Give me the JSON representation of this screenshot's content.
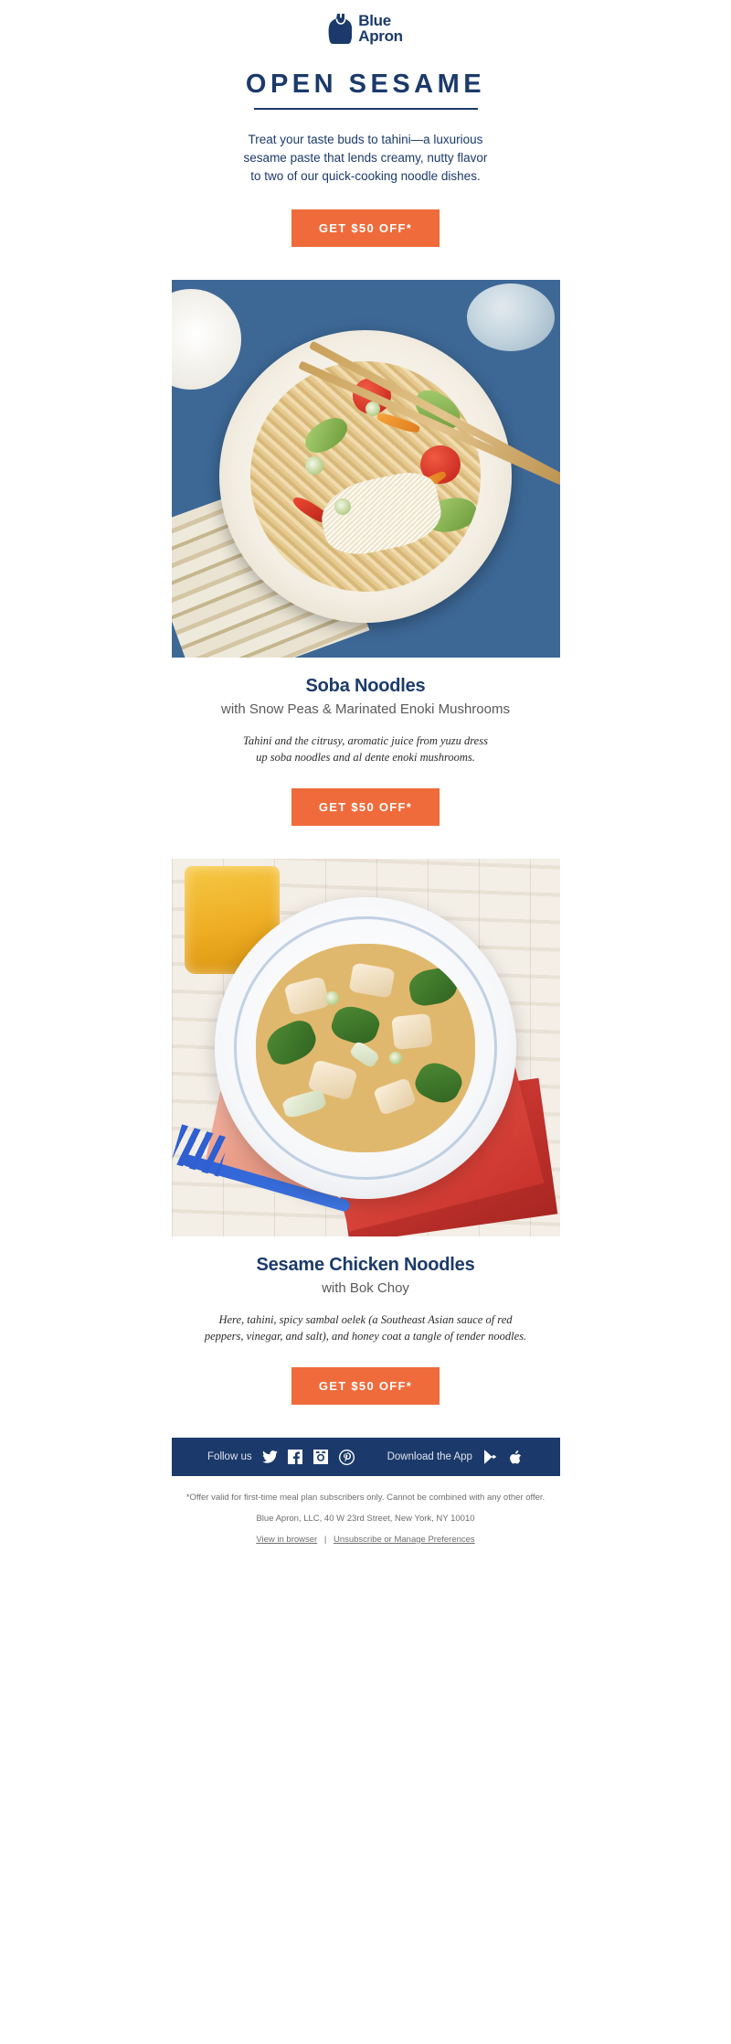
{
  "brand": {
    "name_line1": "Blue",
    "name_line2": "Apron",
    "logo_icon": "apron-icon",
    "navy": "#1b3a6b",
    "orange": "#ef6b3c"
  },
  "hero": {
    "headline": "OPEN SESAME",
    "intro_line1": "Treat your taste buds to tahini—a luxurious",
    "intro_line2": "sesame paste that lends creamy, nutty flavor",
    "intro_line3": "to two of our quick-cooking noodle dishes.",
    "cta_label": "GET $50 OFF*"
  },
  "recipes": [
    {
      "photo_alt": "soba-noodles-photo",
      "title": "Soba Noodles",
      "subtitle": "with Snow Peas & Marinated Enoki Mushrooms",
      "desc_line1": "Tahini and the citrusy, aromatic juice from yuzu dress",
      "desc_line2": "up soba noodles and al dente enoki mushrooms.",
      "cta_label": "GET $50 OFF*"
    },
    {
      "photo_alt": "sesame-chicken-noodles-photo",
      "title": "Sesame Chicken Noodles",
      "subtitle": "with Bok Choy",
      "desc_line1": "Here, tahini, spicy sambal oelek (a Southeast Asian sauce of red",
      "desc_line2": "peppers, vinegar, and salt), and honey coat a tangle of tender noodles.",
      "cta_label": "GET $50 OFF*"
    }
  ],
  "footer": {
    "follow_label": "Follow us",
    "social": [
      {
        "name": "twitter-icon"
      },
      {
        "name": "facebook-icon"
      },
      {
        "name": "instagram-icon"
      },
      {
        "name": "pinterest-icon"
      }
    ],
    "download_label": "Download the App",
    "stores": [
      {
        "name": "google-play-icon"
      },
      {
        "name": "apple-app-store-icon"
      }
    ],
    "disclaimer": "*Offer valid for first-time meal plan subscribers only. Cannot be combined with any other offer.",
    "address": "Blue Apron, LLC, 40 W 23rd Street, New York, NY 10010",
    "link_view": "View in browser",
    "link_separator": "|",
    "link_unsubscribe": "Unsubscribe or Manage Preferences"
  }
}
